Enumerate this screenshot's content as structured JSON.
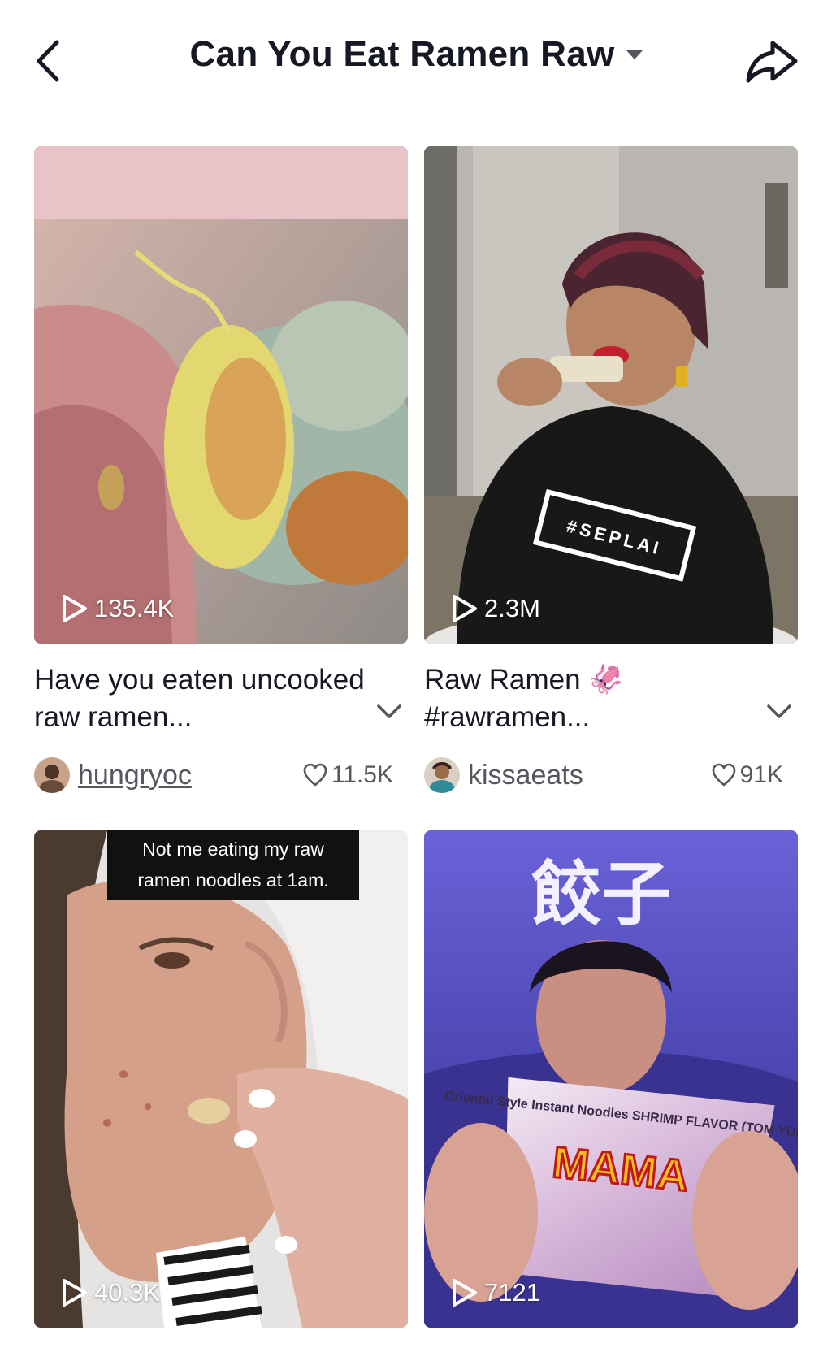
{
  "header": {
    "title": "Can You Eat Ramen Raw",
    "back_icon": "chevron-left-icon",
    "share_icon": "share-arrow-icon",
    "dropdown_icon": "caret-down-icon"
  },
  "videos": [
    {
      "views": "135.4K",
      "caption": "Have you eaten uncooked raw ramen...",
      "username": "hungryoc",
      "likes": "11.5K"
    },
    {
      "views": "2.3M",
      "caption": "Raw Ramen 🦑 #rawramen...",
      "username": "kissaeats",
      "likes": "91K",
      "shirt_text": "#SEPLAI"
    },
    {
      "views": "40.3K",
      "overlay_text": "Not me eating my raw ramen noodles at 1am."
    },
    {
      "views": "7121",
      "neon_text": "餃子",
      "package_text": "Oriental Style Instant Noodles SHRIMP FLAVOR (TOM YUM)",
      "brand_text": "MAMA"
    }
  ],
  "colors": {
    "text_primary": "#161823",
    "text_secondary": "#55575e",
    "background": "#ffffff"
  }
}
